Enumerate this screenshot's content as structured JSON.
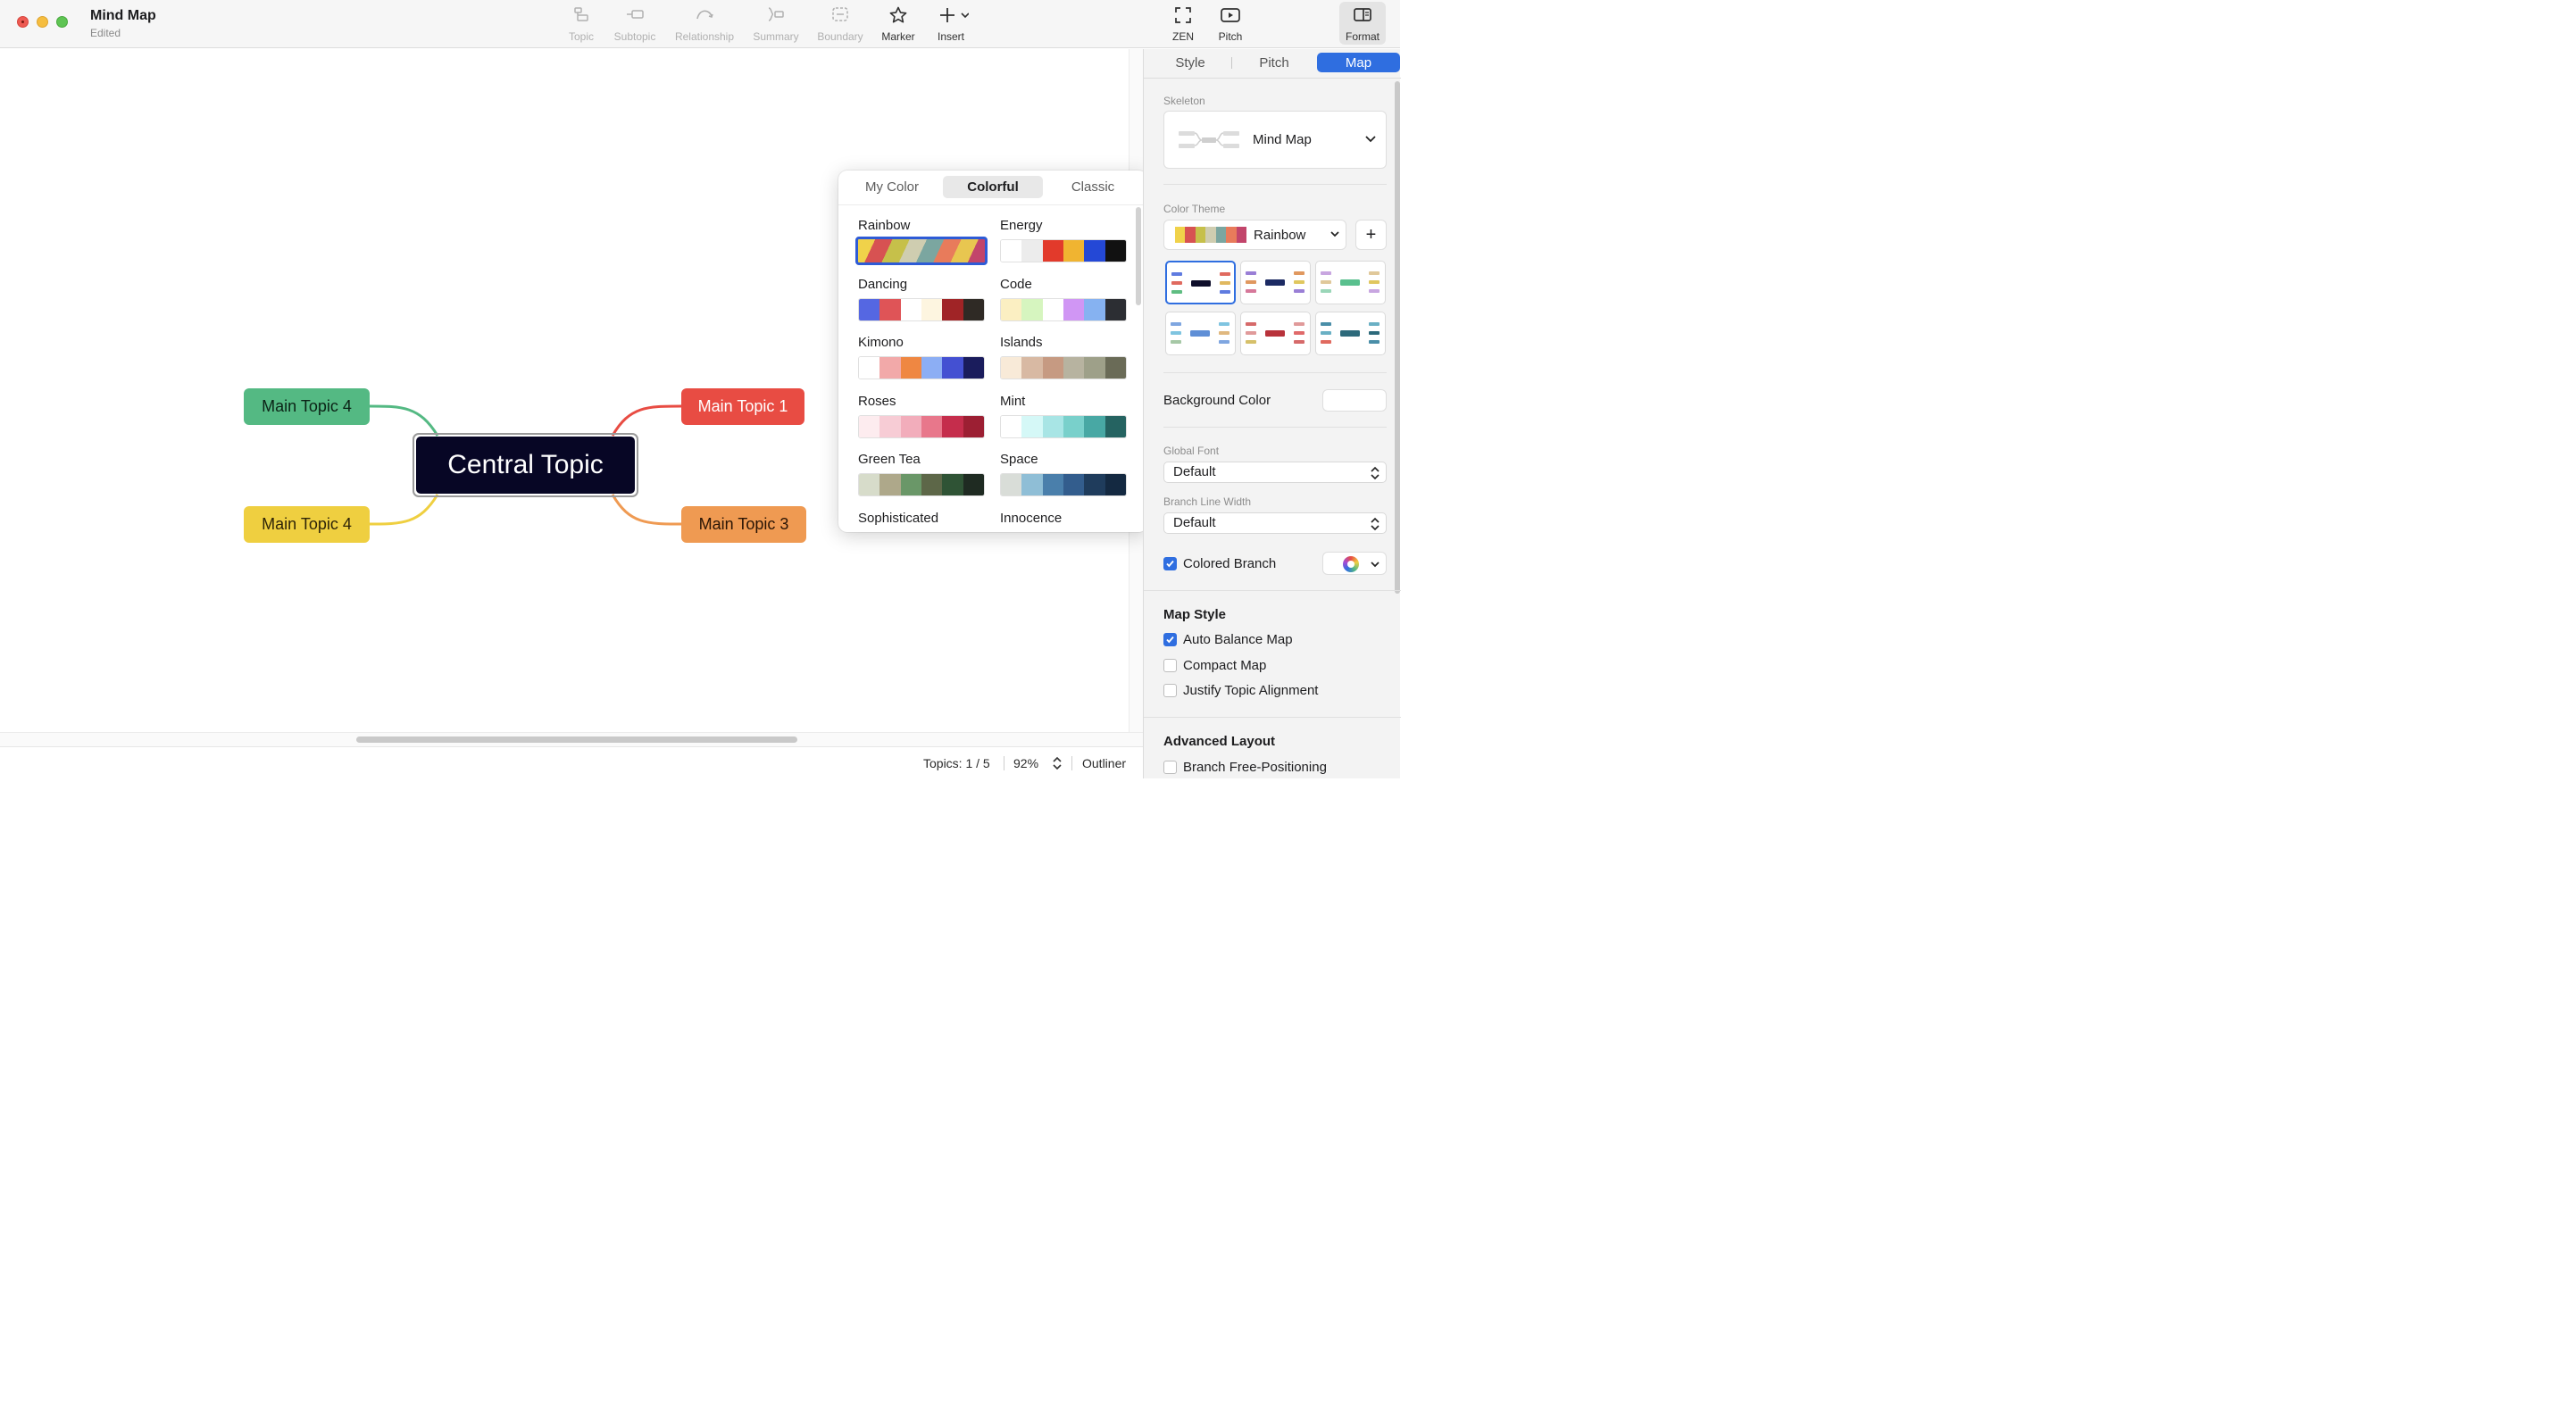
{
  "window": {
    "title": "Mind Map",
    "subtitle": "Edited"
  },
  "toolbar": {
    "topic": "Topic",
    "subtopic": "Subtopic",
    "relationship": "Relationship",
    "summary": "Summary",
    "boundary": "Boundary",
    "marker": "Marker",
    "insert": "Insert",
    "zen": "ZEN",
    "pitch": "Pitch",
    "format": "Format"
  },
  "map": {
    "central": "Central Topic",
    "topics": [
      {
        "label": "Main Topic 4",
        "color": "#54b983"
      },
      {
        "label": "Main Topic 1",
        "color": "#e84c43"
      },
      {
        "label": "Main Topic 4",
        "color": "#efcf40"
      },
      {
        "label": "Main Topic 3",
        "color": "#ef9a52"
      }
    ]
  },
  "popover": {
    "tabs": [
      "My Color",
      "Colorful",
      "Classic"
    ],
    "active_tab": "Colorful",
    "themes": [
      {
        "name": "Rainbow",
        "colors": [
          "#f0d24a",
          "#d75252",
          "#c6c04a",
          "#cfcdb0",
          "#7ba6a0",
          "#e87b5b",
          "#e8c650",
          "#c2456b"
        ],
        "selected": true
      },
      {
        "name": "Energy",
        "colors": [
          "#ffffff",
          "#ececec",
          "#e23a2b",
          "#f0b431",
          "#2448d6",
          "#111111"
        ]
      },
      {
        "name": "Dancing",
        "colors": [
          "#5567e2",
          "#df5457",
          "#ffffff",
          "#fdf5e0",
          "#a02426",
          "#2f2a25"
        ]
      },
      {
        "name": "Code",
        "colors": [
          "#fbefc2",
          "#d6f5bf",
          "#ffffff",
          "#d096f4",
          "#86b2f1",
          "#2c2e33"
        ]
      },
      {
        "name": "Kimono",
        "colors": [
          "#ffffff",
          "#f2a9a9",
          "#ef8742",
          "#8caef4",
          "#4450d2",
          "#1a1c5c"
        ]
      },
      {
        "name": "Islands",
        "colors": [
          "#f8ead8",
          "#d8b9a3",
          "#c69a82",
          "#b7b3a0",
          "#9ea089",
          "#6a6b57"
        ]
      },
      {
        "name": "Roses",
        "colors": [
          "#fdecef",
          "#f7ccd5",
          "#f2adbb",
          "#e8778b",
          "#c52d4c",
          "#9c1f33"
        ]
      },
      {
        "name": "Mint",
        "colors": [
          "#ffffff",
          "#d5f8f7",
          "#a8e5e5",
          "#79d0cb",
          "#48a8a4",
          "#256361"
        ]
      },
      {
        "name": "Green Tea",
        "colors": [
          "#d7dcca",
          "#aea88a",
          "#6a9768",
          "#5d6748",
          "#2f5335",
          "#1f2b22"
        ]
      },
      {
        "name": "Space",
        "colors": [
          "#d9ddd8",
          "#8fbed6",
          "#4a7fab",
          "#335d8d",
          "#1f3c5c",
          "#142941"
        ]
      },
      {
        "name": "Sophisticated",
        "colors": []
      },
      {
        "name": "Innocence",
        "colors": []
      }
    ]
  },
  "panel": {
    "tabs": [
      "Style",
      "Pitch",
      "Map"
    ],
    "active_tab": "Map",
    "skeleton_label": "Skeleton",
    "skeleton_value": "Mind Map",
    "color_theme_label": "Color Theme",
    "color_theme_value": "Rainbow",
    "add_label": "+",
    "background_color_label": "Background Color",
    "global_font_label": "Global Font",
    "global_font_value": "Default",
    "branch_line_width_label": "Branch Line Width",
    "branch_line_width_value": "Default",
    "colored_branch_label": "Colored Branch",
    "colored_branch_checked": true,
    "map_style_title": "Map Style",
    "auto_balance_label": "Auto Balance Map",
    "auto_balance_checked": true,
    "compact_map_label": "Compact Map",
    "compact_map_checked": false,
    "justify_label": "Justify Topic Alignment",
    "justify_checked": false,
    "advanced_layout_title": "Advanced Layout",
    "free_positioning_label": "Branch Free-Positioning",
    "free_positioning_checked": false
  },
  "status": {
    "topics": "Topics: 1 / 5",
    "zoom": "92%",
    "outliner": "Outliner"
  },
  "colors": {
    "accent": "#2f6ee0",
    "central": "#070625",
    "annotation_arrow": "#e9412f"
  }
}
